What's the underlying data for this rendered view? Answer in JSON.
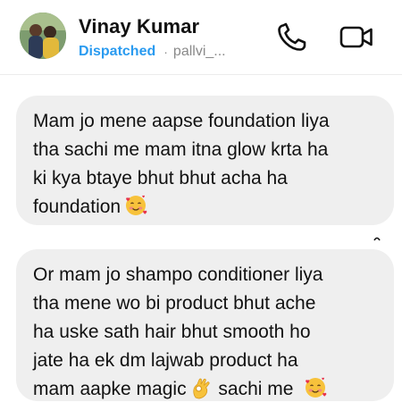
{
  "header": {
    "contact_name": "Vinay Kumar",
    "status_badge": "Dispatched",
    "status_separator": "·",
    "username": "pallvi_..."
  },
  "icons": {
    "avatar": "avatar",
    "call": "phone-icon",
    "video": "video-camera-icon",
    "emoji_smiling_hearts": "smiling-face-with-hearts-emoji",
    "emoji_ok_hand": "ok-hand-emoji"
  },
  "colors": {
    "status_badge": "#2a9bf0",
    "bubble_background": "#efefef",
    "text": "#111111",
    "muted": "#8a8a8a"
  },
  "messages": [
    {
      "text": "Mam jo mene aapse foundation liya\ntha sachi me mam itna glow krta ha\nki kya btaye bhut bhut acha ha\nfoundation"
    },
    {
      "text_part1": "Or  mam jo shampo conditioner liya\ntha mene wo bi product bhut ache\nha uske sath hair bhut smooth ho\njate ha ek dm lajwab product ha\nmam aapke magic",
      "text_part2": " sachi me"
    }
  ]
}
